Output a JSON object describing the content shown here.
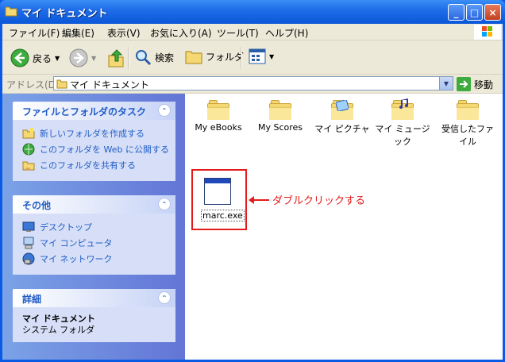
{
  "window": {
    "title": "マイ ドキュメント"
  },
  "menubar": [
    "ファイル(F)",
    "編集(E)",
    "表示(V)",
    "お気に入り(A)",
    "ツール(T)",
    "ヘルプ(H)"
  ],
  "toolbar": {
    "back": "戻る",
    "search": "検索",
    "folders": "フォルダ"
  },
  "address": {
    "label": "アドレス(D)",
    "value": "マイ ドキュメント",
    "go": "移動"
  },
  "sidebar": {
    "tasks_title": "ファイルとフォルダのタスク",
    "tasks": [
      "新しいフォルダを作成する",
      "このフォルダを Web に公開する",
      "このフォルダを共有する"
    ],
    "other_title": "その他",
    "other": [
      "デスクトップ",
      "マイ コンピュータ",
      "マイ ネットワーク"
    ],
    "details_title": "詳細",
    "details_name": "マイ ドキュメント",
    "details_type": "システム フォルダ"
  },
  "items": [
    {
      "label": "My eBooks"
    },
    {
      "label": "My Scores"
    },
    {
      "label": "マイ ピクチャ"
    },
    {
      "label": "マイ ミュージック"
    },
    {
      "label": "受信したファイル"
    }
  ],
  "exe": {
    "label": "marc.exe"
  },
  "callout": "ダブルクリックする"
}
